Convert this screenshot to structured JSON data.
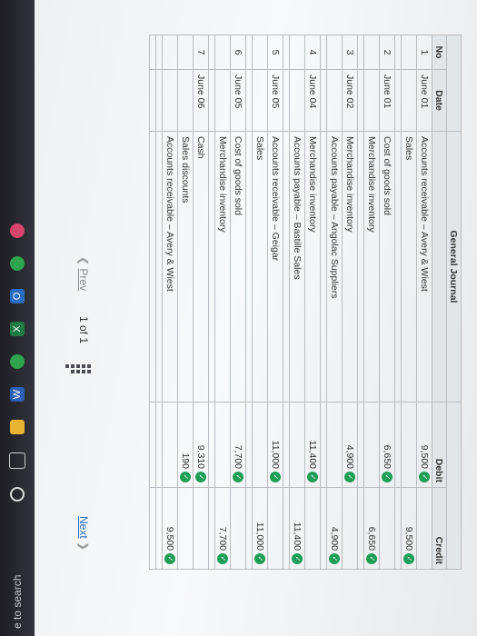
{
  "taskbar": {
    "search_text": "e to search",
    "icons": [
      "cortana-ring-icon",
      "task-view-icon",
      "file-explorer-icon",
      "word-icon",
      "chrome-icon",
      "excel-icon",
      "outlook-icon",
      "edge-icon",
      "app-icon"
    ]
  },
  "journal": {
    "title": "General Journal",
    "headers": {
      "no": "No",
      "date": "Date",
      "description": "General Journal",
      "debit": "Debit",
      "credit": "Credit"
    },
    "rows": [
      {
        "no": "1",
        "date": "June 01",
        "account": "Accounts receivable – Avery & Wiest",
        "indent": false,
        "debit": "9,500",
        "credit": ""
      },
      {
        "no": "",
        "date": "",
        "account": "Sales",
        "indent": true,
        "debit": "",
        "credit": "9,500"
      },
      {
        "sep": true
      },
      {
        "no": "2",
        "date": "June 01",
        "account": "Cost of goods sold",
        "indent": false,
        "debit": "6,650",
        "credit": ""
      },
      {
        "no": "",
        "date": "",
        "account": "Merchandise inventory",
        "indent": true,
        "debit": "",
        "credit": "6,650"
      },
      {
        "sep": true
      },
      {
        "no": "3",
        "date": "June 02",
        "account": "Merchandise inventory",
        "indent": false,
        "debit": "4,900",
        "credit": ""
      },
      {
        "no": "",
        "date": "",
        "account": "Accounts payable – Angolac Suppliers",
        "indent": true,
        "debit": "",
        "credit": "4,900"
      },
      {
        "sep": true
      },
      {
        "no": "4",
        "date": "June 04",
        "account": "Merchandise inventory",
        "indent": false,
        "debit": "11,400",
        "credit": ""
      },
      {
        "no": "",
        "date": "",
        "account": "Accounts payable – Bastille Sales",
        "indent": true,
        "debit": "",
        "credit": "11,400"
      },
      {
        "sep": true
      },
      {
        "no": "5",
        "date": "June 05",
        "account": "Accounts receivable – Geigar",
        "indent": false,
        "debit": "11,000",
        "credit": ""
      },
      {
        "no": "",
        "date": "",
        "account": "Sales",
        "indent": true,
        "debit": "",
        "credit": "11,000"
      },
      {
        "sep": true
      },
      {
        "no": "6",
        "date": "June 05",
        "account": "Cost of goods sold",
        "indent": false,
        "debit": "7,700",
        "credit": ""
      },
      {
        "no": "",
        "date": "",
        "account": "Merchandise inventory",
        "indent": true,
        "debit": "",
        "credit": "7,700"
      },
      {
        "sep": true
      },
      {
        "no": "7",
        "date": "June 06",
        "account": "Cash",
        "indent": false,
        "debit": "9,310",
        "credit": ""
      },
      {
        "no": "",
        "date": "",
        "account": "Sales discounts",
        "indent": false,
        "debit": "190",
        "credit": ""
      },
      {
        "no": "",
        "date": "",
        "account": "Accounts receivable – Avery & Wiest",
        "indent": true,
        "debit": "",
        "credit": "9,500"
      },
      {
        "sep": true
      },
      {
        "sep": true
      }
    ]
  },
  "pager": {
    "prev_label": "Prev",
    "page_info": "1 of 1",
    "next_label": "Next"
  },
  "colors": {
    "check_green": "#1f9e56",
    "header_bg": "#e3e6e9",
    "link_blue": "#2a6cc0"
  }
}
